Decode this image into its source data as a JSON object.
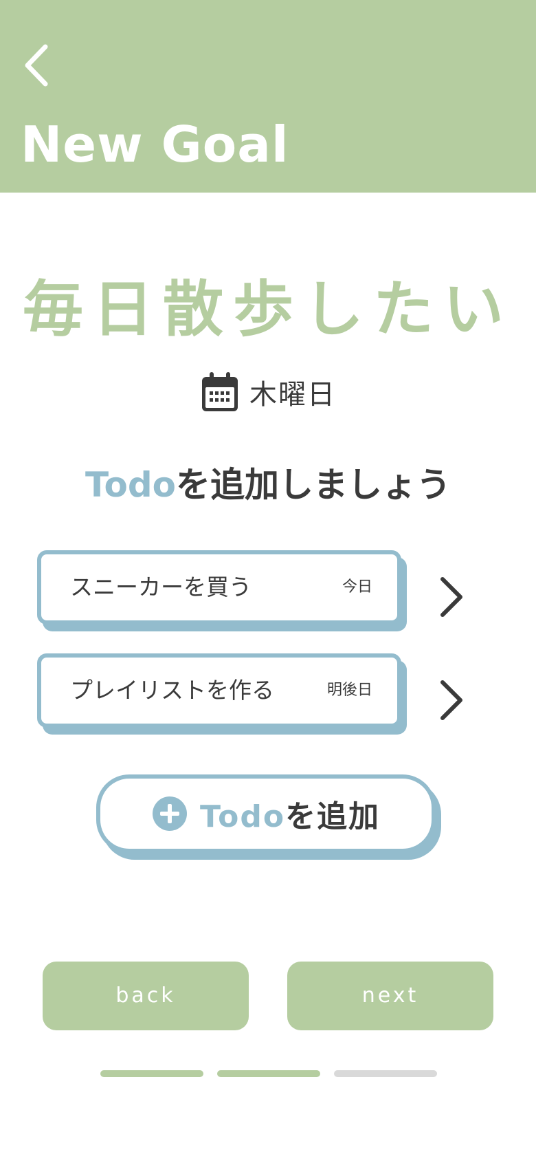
{
  "header": {
    "title": "New Goal",
    "back_icon": "chevron-left-icon",
    "background": "#b5cda0"
  },
  "goal": {
    "title": "毎日散歩したい",
    "day_icon": "calendar-icon",
    "day": "木曜日"
  },
  "section": {
    "title_accent": "Todo",
    "title_rest": "を追加しましょう"
  },
  "todos": [
    {
      "title": "スニーカーを買う",
      "date": "今日",
      "icon": "chevron-right-icon"
    },
    {
      "title": "プレイリストを作る",
      "date": "明後日",
      "icon": "chevron-right-icon"
    }
  ],
  "add_button": {
    "icon": "plus-circle-icon",
    "label_accent": "Todo",
    "label_rest": "を追加"
  },
  "footer": {
    "back_label": "back",
    "next_label": "next"
  },
  "progress": {
    "total_steps": 3,
    "completed_steps": 2,
    "active_color": "#b5cda0",
    "inactive_color": "#d9d9d9"
  },
  "colors": {
    "primary_green": "#b5cda0",
    "accent_blue": "#93bccd",
    "text_dark": "#3a3a3a"
  }
}
